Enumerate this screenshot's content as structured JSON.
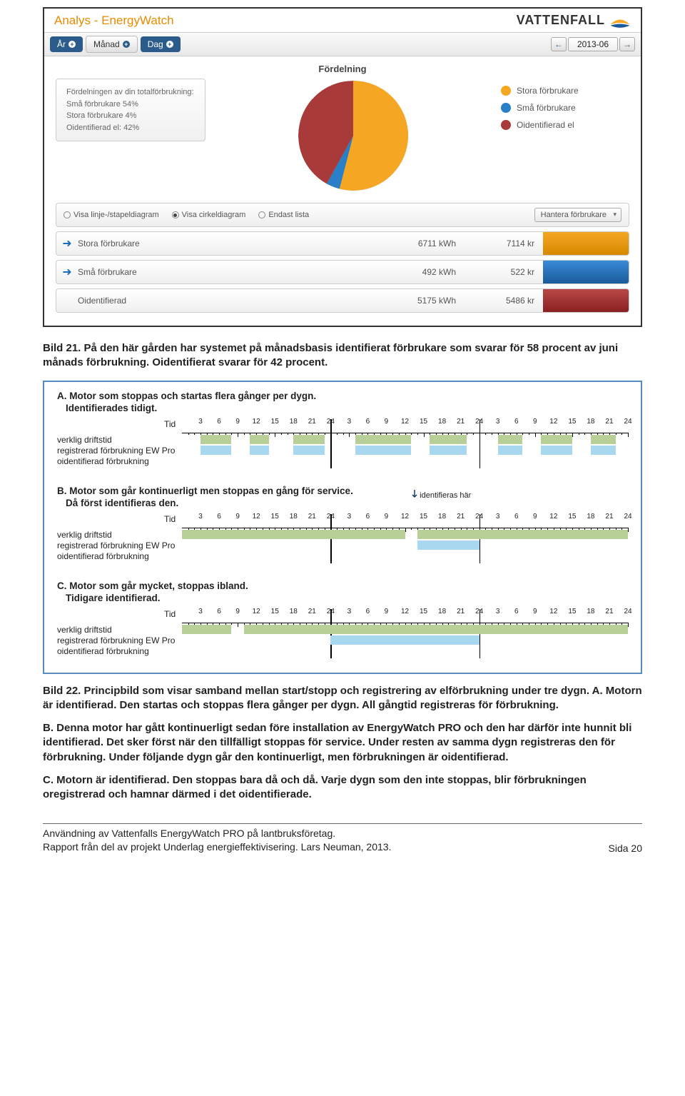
{
  "app": {
    "title": "Analys - EnergyWatch",
    "brand": "VATTENFALL",
    "tabs": {
      "year": "År",
      "month": "Månad",
      "day": "Dag"
    },
    "period": "2013-06",
    "chart_title": "Fördelning",
    "infobox": {
      "line1": "Fördelningen av din totalförbrukning:",
      "line2": "Små förbrukare 54%",
      "line3": "Stora förbrukare 4%",
      "line4": "Oidentifierad el: 42%"
    },
    "legend": [
      {
        "label": "Stora förbrukare",
        "color": "#f5a623"
      },
      {
        "label": "Små förbrukare",
        "color": "#2a7fc9"
      },
      {
        "label": "Oidentifierad el",
        "color": "#a83a3a"
      }
    ],
    "controls": {
      "opt1": "Visa linje-/stapeldiagram",
      "opt2": "Visa cirkeldiagram",
      "opt3": "Endast lista",
      "dropdown": "Hantera förbrukare"
    },
    "rows": [
      {
        "name": "Stora förbrukare",
        "kwh": "6711 kWh",
        "kr": "7114 kr",
        "bar": "orange",
        "icon": true
      },
      {
        "name": "Små förbrukare",
        "kwh": "492 kWh",
        "kr": "522 kr",
        "bar": "blue",
        "icon": true
      },
      {
        "name": "Oidentifierad",
        "kwh": "5175 kWh",
        "kr": "5486 kr",
        "bar": "red",
        "icon": false
      }
    ]
  },
  "chart_data": {
    "type": "pie",
    "title": "Fördelning",
    "series": [
      {
        "name": "Stora förbrukare",
        "value": 54,
        "color": "#f5a623"
      },
      {
        "name": "Små förbrukare",
        "value": 4,
        "color": "#2a7fc9"
      },
      {
        "name": "Oidentifierad el",
        "value": 42,
        "color": "#a83a3a"
      }
    ]
  },
  "caption21": {
    "lead": "Bild 21.",
    "text": " På den här gården har systemet på månadsbasis identifierat förbrukare som svarar för 58 procent av juni månads förbrukning. Oidentifierat svarar för 42 procent."
  },
  "tl": {
    "ticks": [
      "3",
      "6",
      "9",
      "12",
      "15",
      "18",
      "21",
      "24",
      "3",
      "6",
      "9",
      "12",
      "15",
      "18",
      "21",
      "24",
      "3",
      "6",
      "9",
      "12",
      "15",
      "18",
      "21",
      "24"
    ],
    "tid": "Tid",
    "row_labels": {
      "a": "verklig driftstid",
      "b": "registrerad förbrukning EW Pro",
      "c": "oidentifierad förbrukning"
    },
    "A": {
      "title": "A. Motor som stoppas och startas flera gånger per dygn.",
      "sub": "Identifierades tidigt."
    },
    "B": {
      "title": "B. Motor som går kontinuerligt men stoppas en gång för service.",
      "sub": "Då först identifieras den.",
      "arrow": "identifieras här"
    },
    "C": {
      "title": "C. Motor som går mycket, stoppas ibland.",
      "sub": "Tidigare identifierad."
    }
  },
  "caption22": {
    "lead": "Bild 22.",
    "rest": " Principbild som visar samband mellan start/stopp och registrering av elförbrukning under tre dygn.",
    "pA": " A. Motorn är identifierad. Den startas och stoppas flera gånger per dygn. All gångtid registreras för förbrukning.",
    "pB": "B. Denna motor har gått kontinuerligt sedan före installation av EnergyWatch PRO och den har därför inte hunnit bli identifierad. Det sker först när den tillfälligt stoppas för service. Under resten av samma dygn registreras den för förbrukning. Under följande dygn går den kontinuerligt, men förbrukningen är oidentifierad.",
    "pC": "C. Motorn är identifierad. Den stoppas bara då och då. Varje dygn som den inte stoppas, blir förbrukningen oregistrerad och hamnar därmed i det oidentifierade."
  },
  "footer": {
    "l1": "Användning av Vattenfalls EnergyWatch PRO på lantbruksföretag.",
    "l2": "Rapport från del av projekt Underlag energieffektivisering. Lars Neuman, 2013.",
    "page": "Sida 20"
  }
}
